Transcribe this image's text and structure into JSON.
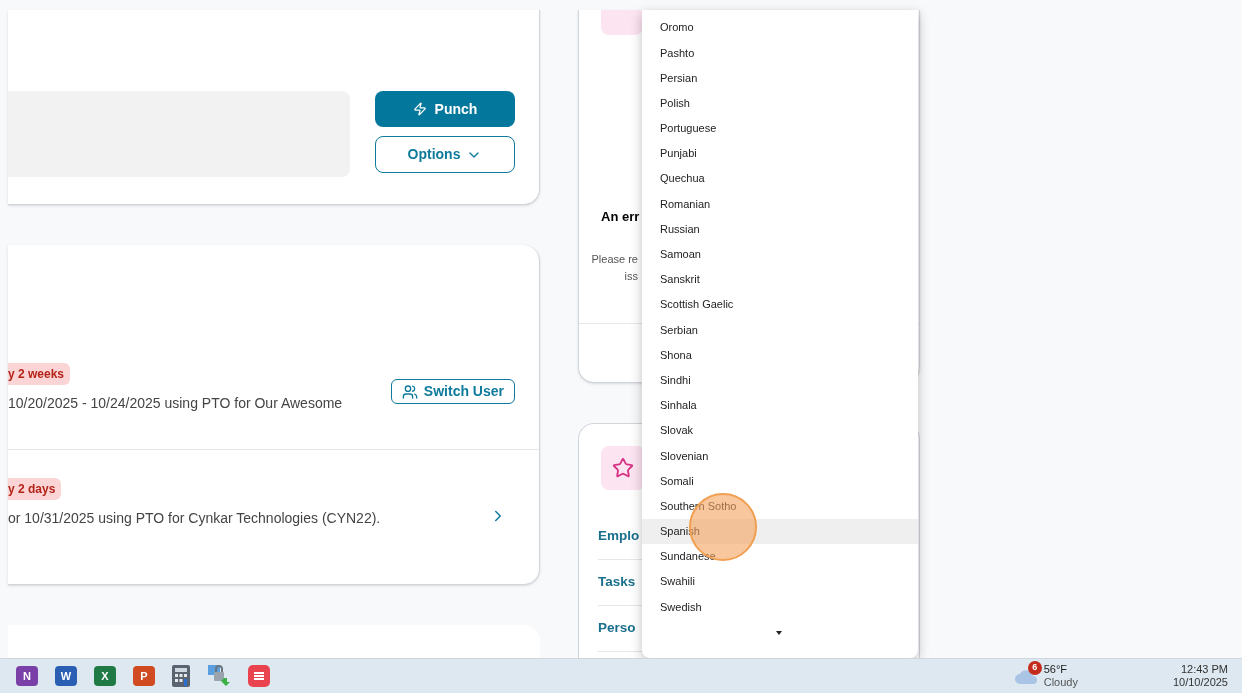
{
  "punch_card": {
    "primary_button": "Punch",
    "options_button": "Options"
  },
  "requests_card": {
    "rows": [
      {
        "badge": "y 2 weeks",
        "text": "10/20/2025 - 10/24/2025 using PTO for Our Awesome",
        "kind": "switch",
        "action": "Switch User"
      },
      {
        "badge": "y 2 days",
        "text": "or 10/31/2025 using PTO for Cynkar Technologies (CYN22).",
        "kind": "chevron"
      }
    ]
  },
  "error_card": {
    "title": "An err",
    "message_lines": [
      "Please re",
      "iss"
    ]
  },
  "links_card": {
    "links": [
      "Emplo",
      "Tasks",
      "Perso"
    ]
  },
  "language_dropdown": {
    "items": [
      {
        "label": "Oromo",
        "selected": false
      },
      {
        "label": "Pashto",
        "selected": false
      },
      {
        "label": "Persian",
        "selected": false
      },
      {
        "label": "Polish",
        "selected": false
      },
      {
        "label": "Portuguese",
        "selected": false
      },
      {
        "label": "Punjabi",
        "selected": false
      },
      {
        "label": "Quechua",
        "selected": false
      },
      {
        "label": "Romanian",
        "selected": false
      },
      {
        "label": "Russian",
        "selected": false
      },
      {
        "label": "Samoan",
        "selected": false
      },
      {
        "label": "Sanskrit",
        "selected": false
      },
      {
        "label": "Scottish Gaelic",
        "selected": false
      },
      {
        "label": "Serbian",
        "selected": false
      },
      {
        "label": "Shona",
        "selected": false
      },
      {
        "label": "Sindhi",
        "selected": false
      },
      {
        "label": "Sinhala",
        "selected": false
      },
      {
        "label": "Slovak",
        "selected": false
      },
      {
        "label": "Slovenian",
        "selected": false
      },
      {
        "label": "Somali",
        "selected": false
      },
      {
        "label": "Southern Sotho",
        "selected": false
      },
      {
        "label": "Spanish",
        "selected": true
      },
      {
        "label": "Sundanese",
        "selected": false
      },
      {
        "label": "Swahili",
        "selected": false
      },
      {
        "label": "Swedish",
        "selected": false
      }
    ]
  },
  "taskbar": {
    "apps": [
      {
        "letter": "N",
        "color": "#7b3fa8"
      },
      {
        "letter": "W",
        "color": "#2b5fb4"
      },
      {
        "letter": "X",
        "color": "#1f7a45"
      },
      {
        "letter": "P",
        "color": "#d04a22"
      }
    ],
    "weather": {
      "badge": "6",
      "temperature": "56°F",
      "condition": "Cloudy"
    },
    "clock": {
      "time": "12:43 PM",
      "date": "10/10/2025"
    }
  }
}
